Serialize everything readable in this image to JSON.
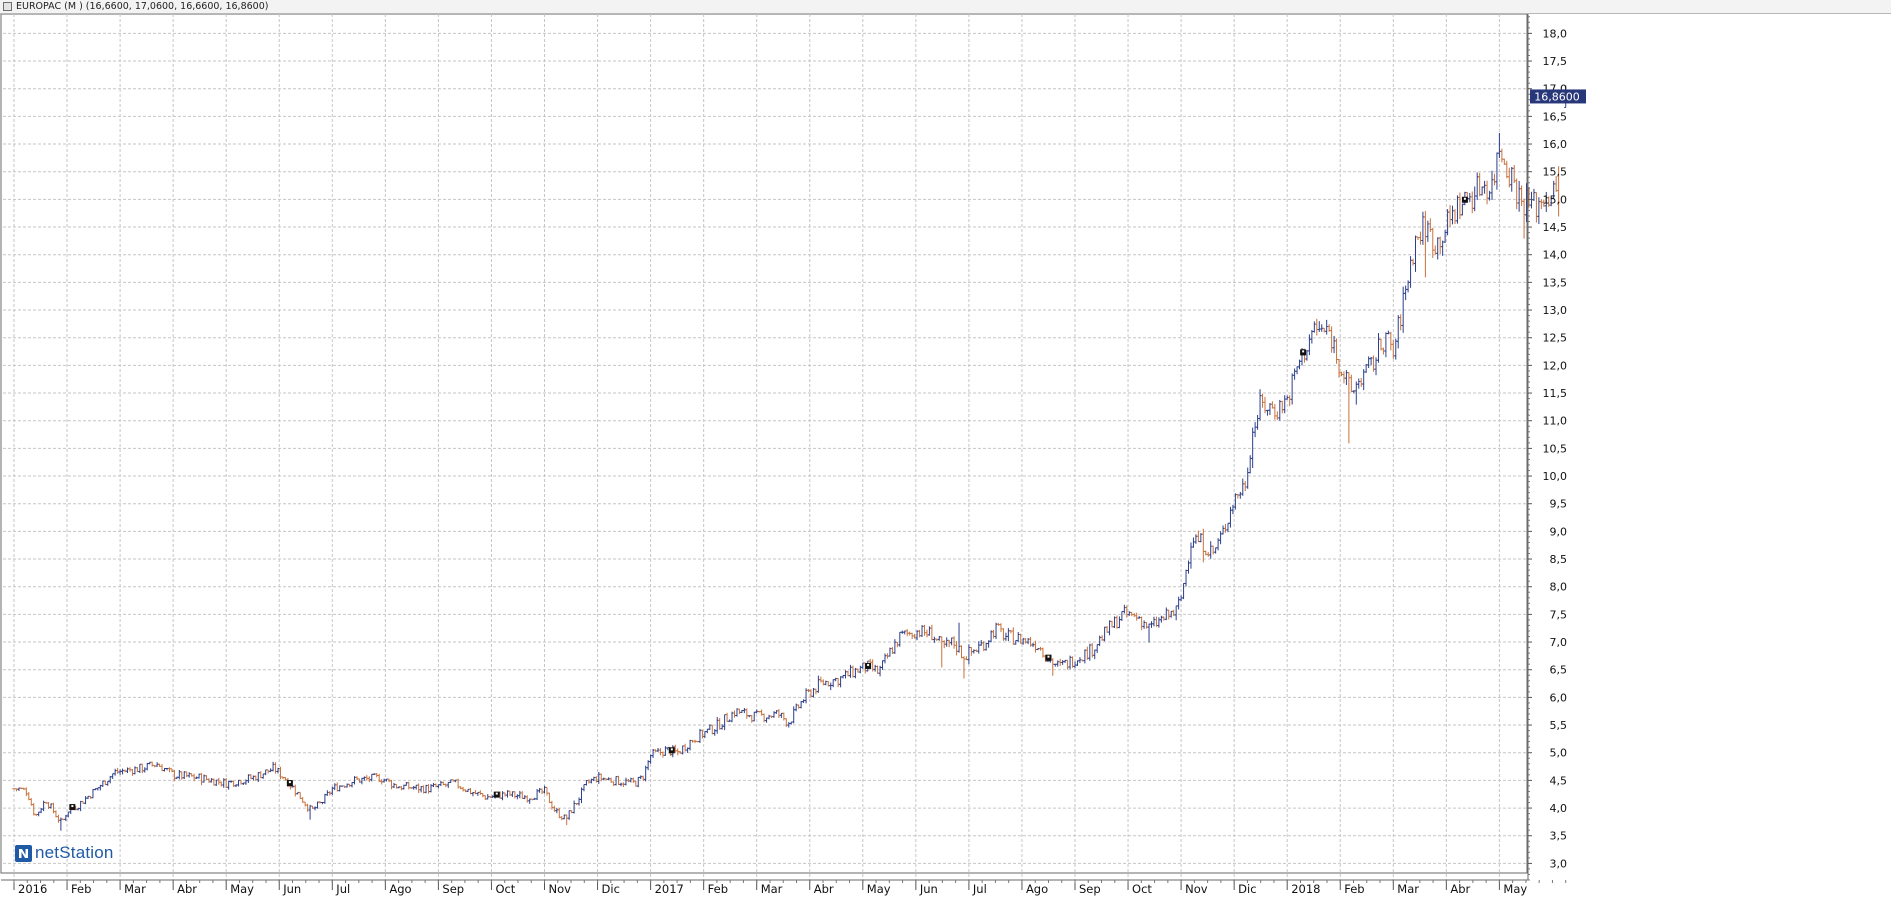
{
  "window": {
    "title": "EUROPAC (M ) (16,6600, 17,0600, 16,6600, 16,8600)"
  },
  "logo": {
    "text": "netStation"
  },
  "last_price_label": "16,8600",
  "colors": {
    "up": "#2b3f8c",
    "down": "#c8713c",
    "grid": "#c6c6c6",
    "price_tag": "#28377a"
  },
  "chart_data": {
    "type": "bar",
    "subtype": "ohlc",
    "title": "EUROPAC (M )",
    "grid": true,
    "y_axis_position": "right",
    "ylim": [
      2.7,
      18.35
    ],
    "y_ticks": [
      3.0,
      3.5,
      4.0,
      4.5,
      5.0,
      5.5,
      6.0,
      6.5,
      7.0,
      7.5,
      8.0,
      8.5,
      9.0,
      9.5,
      10.0,
      10.5,
      11.0,
      11.5,
      12.0,
      12.5,
      13.0,
      13.5,
      14.0,
      14.5,
      15.0,
      15.5,
      16.0,
      16.5,
      17.0,
      17.5,
      18.0
    ],
    "y_tick_labels": [
      "3,0",
      "3,5",
      "4,0",
      "4,5",
      "5,0",
      "5,5",
      "6,0",
      "6,5",
      "7,0",
      "7,5",
      "8,0",
      "8,5",
      "9,0",
      "9,5",
      "10,0",
      "10,5",
      "11,0",
      "11,5",
      "12,0",
      "12,5",
      "13,0",
      "13,5",
      "14,0",
      "14,5",
      "15,0",
      "15,5",
      "16,0",
      "16,5",
      "17,0",
      "17,5",
      "18,0"
    ],
    "x_labels": [
      "2016",
      "Feb",
      "Mar",
      "Abr",
      "May",
      "Jun",
      "Jul",
      "Ago",
      "Sep",
      "Oct",
      "Nov",
      "Dic",
      "2017",
      "Feb",
      "Mar",
      "Abr",
      "May",
      "Jun",
      "Jul",
      "Ago",
      "Sep",
      "Oct",
      "Nov",
      "Dic",
      "2018",
      "Feb",
      "Mar",
      "Abr",
      "May"
    ],
    "last_bar": {
      "open": 16.66,
      "high": 17.06,
      "low": 16.66,
      "close": 16.86
    },
    "close_path": [
      [
        0,
        4.35
      ],
      [
        0.08,
        4.35
      ],
      [
        0.25,
        4.3
      ],
      [
        0.4,
        3.85
      ],
      [
        0.6,
        4.15
      ],
      [
        0.9,
        3.72
      ],
      [
        1.0,
        3.95
      ],
      [
        1.2,
        4.05
      ],
      [
        1.5,
        4.3
      ],
      [
        1.9,
        4.65
      ],
      [
        2.4,
        4.72
      ],
      [
        2.7,
        4.8
      ],
      [
        3.0,
        4.6
      ],
      [
        3.5,
        4.55
      ],
      [
        4.0,
        4.45
      ],
      [
        4.5,
        4.55
      ],
      [
        4.9,
        4.72
      ],
      [
        5.1,
        4.55
      ],
      [
        5.4,
        4.2
      ],
      [
        5.6,
        3.95
      ],
      [
        5.8,
        4.1
      ],
      [
        6.0,
        4.35
      ],
      [
        6.4,
        4.5
      ],
      [
        6.9,
        4.55
      ],
      [
        7.2,
        4.4
      ],
      [
        7.8,
        4.35
      ],
      [
        8.3,
        4.45
      ],
      [
        8.6,
        4.3
      ],
      [
        8.9,
        4.2
      ],
      [
        9.3,
        4.25
      ],
      [
        9.7,
        4.2
      ],
      [
        10.0,
        4.3
      ],
      [
        10.2,
        3.95
      ],
      [
        10.4,
        3.8
      ],
      [
        10.6,
        4.1
      ],
      [
        10.8,
        4.45
      ],
      [
        11.0,
        4.55
      ],
      [
        11.3,
        4.5
      ],
      [
        11.7,
        4.45
      ],
      [
        11.85,
        4.55
      ],
      [
        12.0,
        4.95
      ],
      [
        12.3,
        5.05
      ],
      [
        12.5,
        5.0
      ],
      [
        12.8,
        5.25
      ],
      [
        13.2,
        5.45
      ],
      [
        13.6,
        5.75
      ],
      [
        14.0,
        5.65
      ],
      [
        14.4,
        5.7
      ],
      [
        14.6,
        5.55
      ],
      [
        14.9,
        6.0
      ],
      [
        15.2,
        6.25
      ],
      [
        15.6,
        6.35
      ],
      [
        15.9,
        6.5
      ],
      [
        16.1,
        6.55
      ],
      [
        16.3,
        6.45
      ],
      [
        16.5,
        6.8
      ],
      [
        16.7,
        7.1
      ],
      [
        17.0,
        7.2
      ],
      [
        17.3,
        7.15
      ],
      [
        17.5,
        6.9
      ],
      [
        17.7,
        7.0
      ],
      [
        17.9,
        6.75
      ],
      [
        18.1,
        6.85
      ],
      [
        18.3,
        7.0
      ],
      [
        18.5,
        7.25
      ],
      [
        18.7,
        7.1
      ],
      [
        19.0,
        7.05
      ],
      [
        19.3,
        6.95
      ],
      [
        19.5,
        6.7
      ],
      [
        19.7,
        6.55
      ],
      [
        20.0,
        6.7
      ],
      [
        20.3,
        6.85
      ],
      [
        20.6,
        7.2
      ],
      [
        20.9,
        7.5
      ],
      [
        21.2,
        7.45
      ],
      [
        21.4,
        7.25
      ],
      [
        21.7,
        7.45
      ],
      [
        21.9,
        7.55
      ],
      [
        22.0,
        7.8
      ],
      [
        22.2,
        8.9
      ],
      [
        22.4,
        8.8
      ],
      [
        22.6,
        8.6
      ],
      [
        22.8,
        9.0
      ],
      [
        23.0,
        9.6
      ],
      [
        23.2,
        9.85
      ],
      [
        23.35,
        10.8
      ],
      [
        23.5,
        11.3
      ],
      [
        23.8,
        11.2
      ],
      [
        24.0,
        11.4
      ],
      [
        24.2,
        12.0
      ],
      [
        24.5,
        12.65
      ],
      [
        24.8,
        12.6
      ],
      [
        25.0,
        12.0
      ],
      [
        25.2,
        11.5
      ],
      [
        25.4,
        11.8
      ],
      [
        25.6,
        12.0
      ],
      [
        25.85,
        12.55
      ],
      [
        26.0,
        12.2
      ],
      [
        26.2,
        13.2
      ],
      [
        26.4,
        14.2
      ],
      [
        26.6,
        14.55
      ],
      [
        26.8,
        14.2
      ],
      [
        27.0,
        14.5
      ],
      [
        27.2,
        14.85
      ],
      [
        27.5,
        15.1
      ],
      [
        27.7,
        15.3
      ],
      [
        27.85,
        15.2
      ],
      [
        28.0,
        15.95
      ],
      [
        28.2,
        15.5
      ],
      [
        28.4,
        15.0
      ],
      [
        28.7,
        14.9
      ],
      [
        28.9,
        15.1
      ],
      [
        29.1,
        15.05
      ]
    ],
    "lows": [
      {
        "x": 0.9,
        "low": 3.6
      },
      {
        "x": 5.6,
        "low": 3.8
      },
      {
        "x": 10.4,
        "low": 3.7
      },
      {
        "x": 17.5,
        "low": 6.55
      },
      {
        "x": 17.9,
        "low": 6.35
      },
      {
        "x": 19.6,
        "low": 6.4
      },
      {
        "x": 21.4,
        "low": 7.0
      },
      {
        "x": 22.4,
        "low": 8.45
      },
      {
        "x": 25.15,
        "low": 10.6
      },
      {
        "x": 25.3,
        "low": 11.3
      },
      {
        "x": 26.6,
        "low": 13.6
      },
      {
        "x": 28.45,
        "low": 14.3
      },
      {
        "x": 29.1,
        "low": 14.7
      }
    ],
    "highs": [
      {
        "x": 17.8,
        "high": 7.35
      },
      {
        "x": 18.5,
        "high": 7.35
      },
      {
        "x": 24.6,
        "high": 12.8
      },
      {
        "x": 26.55,
        "high": 14.65
      },
      {
        "x": 28.0,
        "high": 16.2
      },
      {
        "x": 29.1,
        "high": 15.6
      }
    ],
    "dividends": [
      1.1,
      5.2,
      9.1,
      12.4,
      16.1,
      19.5,
      24.3,
      27.35
    ],
    "last_bar_x": 29.25,
    "x_max": 29.4
  }
}
